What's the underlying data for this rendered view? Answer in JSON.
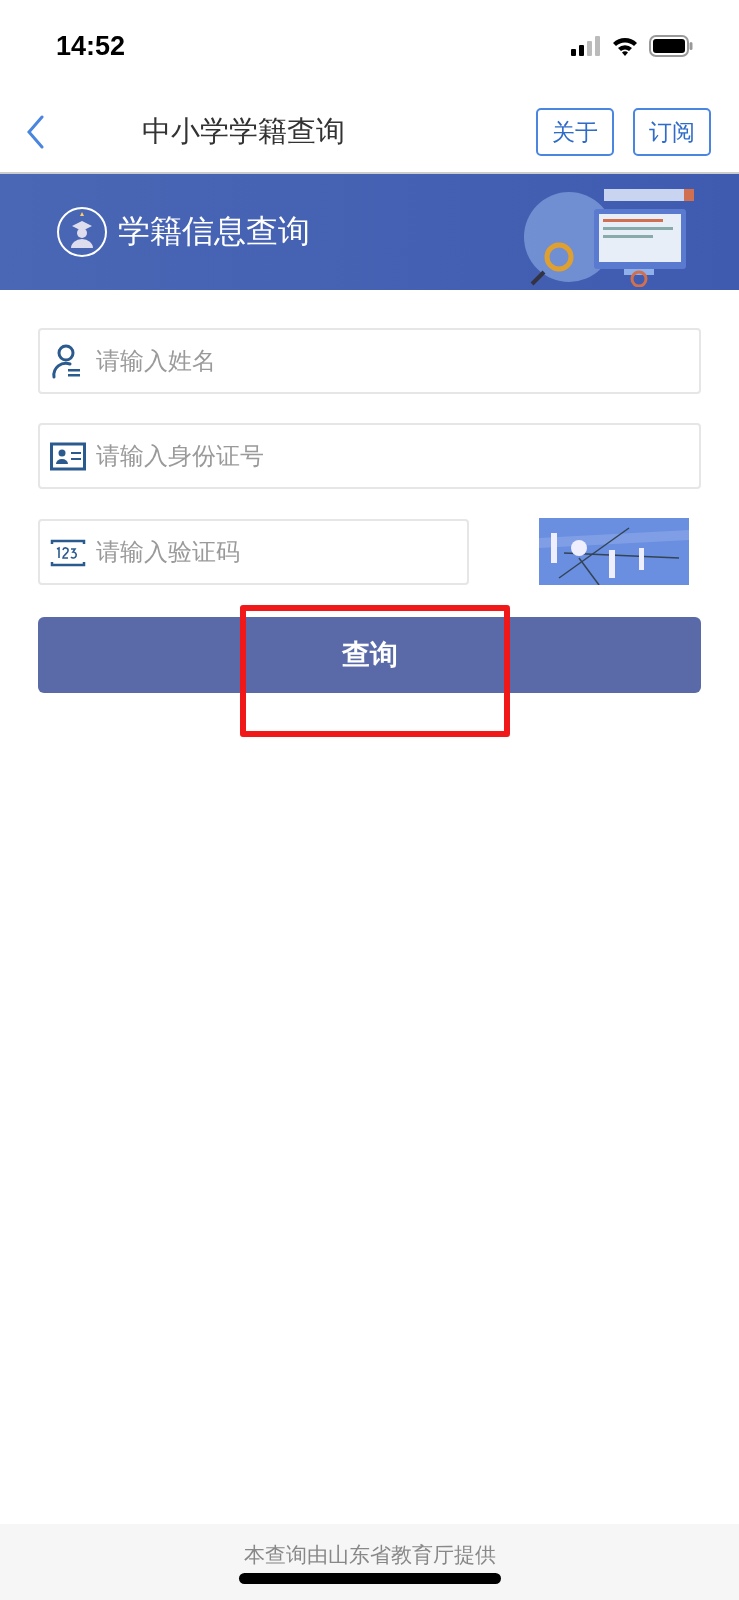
{
  "status_bar": {
    "time": "14:52"
  },
  "nav": {
    "title": "中小学学籍查询",
    "buttons": [
      "关于",
      "订阅"
    ]
  },
  "banner": {
    "title": "学籍信息查询"
  },
  "fields": [
    {
      "kind": "person",
      "placeholder": "请输入姓名"
    },
    {
      "kind": "idcard",
      "placeholder": "请输入身份证号"
    },
    {
      "kind": "code",
      "placeholder": "请输入验证码"
    }
  ],
  "submit_button": {
    "label": "查询",
    "highlighted": true
  },
  "footer": {
    "text": "本查询由山东省教育厅提供"
  }
}
